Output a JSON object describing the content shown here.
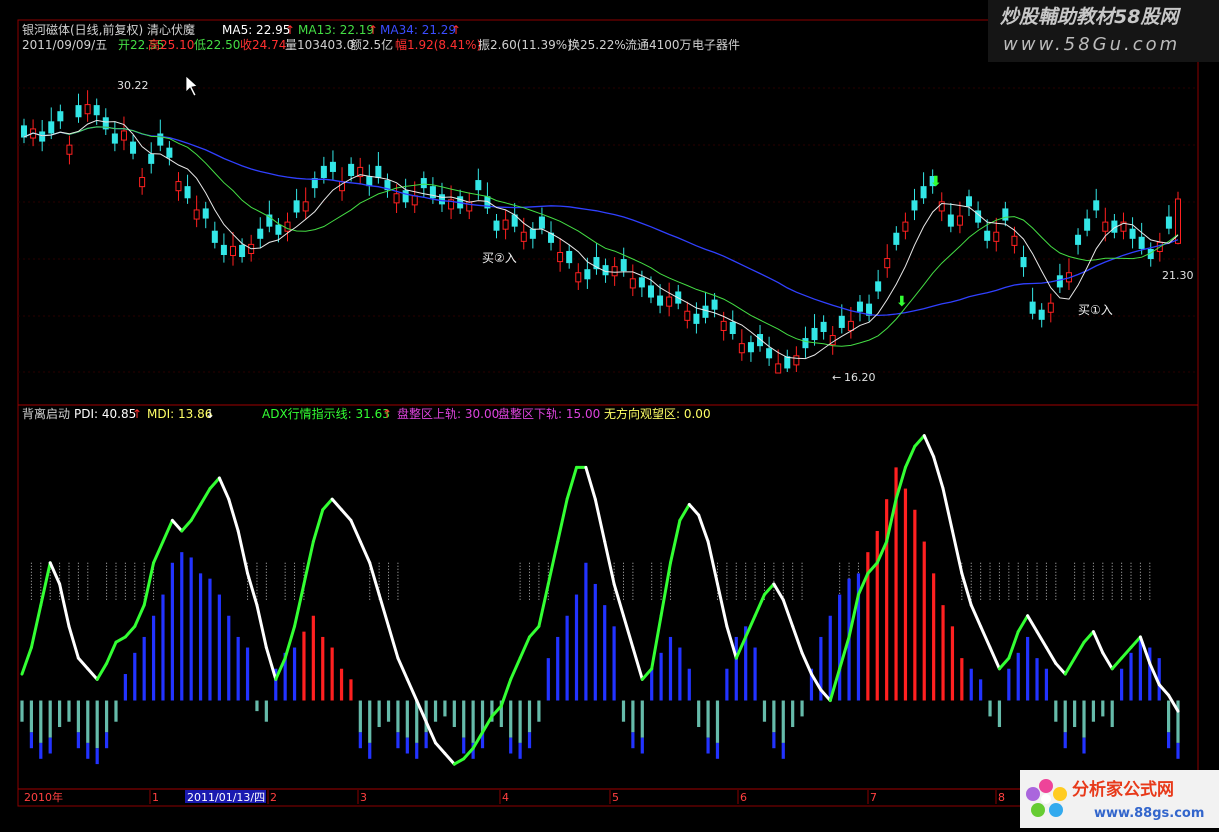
{
  "header": {
    "stock_name": "银河磁体(日线,前复权)",
    "formula_name": "清心伏魔",
    "ma5": "MA5: 22.95",
    "ma13": "MA13: 22.19",
    "ma34": "MA34: 21.29",
    "date": "2011/09/09/五",
    "open": "开22.55",
    "high": "高25.10",
    "low": "低22.50",
    "close": "收24.74",
    "volume": "量103403.0",
    "amount": "额2.5亿",
    "change": "幅1.92(8.41%)",
    "amplitude": "振2.60(11.39%)",
    "turnover": "换25.22%",
    "float_shares": "流通4100万",
    "sector": "电子器件"
  },
  "branding": {
    "top_title": "炒股輔助教材58股网",
    "top_url": "www.58Gu.com",
    "bottom_title": "分析家公式网",
    "bottom_url": "www.88gs.com"
  },
  "indicator": {
    "name": "背离启动",
    "pdi": "PDI: 40.85",
    "mdi": "MDI: 13.86",
    "adx": "ADX行情指示线: 31.63",
    "upper": "盘整区上轨: 30.00",
    "lower": "盘整区下轨: 15.00",
    "neutral": "无方向观望区: 0.00"
  },
  "annotations": {
    "high_label": "30.22",
    "low_label": "16.20",
    "right_price": "21.30",
    "buy1": "买①入",
    "buy2": "买②入"
  },
  "timeline": {
    "year": "2010年",
    "cursor_date": "2011/01/13/四",
    "months": [
      "1",
      "2",
      "3",
      "4",
      "5",
      "6",
      "7",
      "8"
    ]
  },
  "colors": {
    "background": "#000000",
    "up_candle": "#ff2020",
    "down_candle": "#33e6e6",
    "ma5": "#ffffff",
    "ma13": "#44dd44",
    "ma34": "#3040ff",
    "grid": "#8b0000",
    "pdi_bar": "#ff2020",
    "mdi_bar": "#2233ff",
    "adx_up": "#33ff33",
    "adx_down": "#ffffff"
  },
  "chart_data": [
    {
      "type": "candlestick",
      "title": "银河磁体(日线,前复权)",
      "ylim": [
        16.2,
        30.22
      ],
      "price_high": 30.22,
      "price_low": 16.2,
      "last_bar": {
        "open": 22.55,
        "high": 25.1,
        "low": 22.5,
        "close": 24.74
      },
      "close_series": [
        27.8,
        28.2,
        27.6,
        28.0,
        28.6,
        27.4,
        28.8,
        29.4,
        28.9,
        28.2,
        27.5,
        28.1,
        27.0,
        25.8,
        26.5,
        27.4,
        26.8,
        25.6,
        24.8,
        24.2,
        23.8,
        22.6,
        22.0,
        22.4,
        21.9,
        22.5,
        22.8,
        23.4,
        23.0,
        23.6,
        24.1,
        24.6,
        25.3,
        25.8,
        26.1,
        25.6,
        25.9,
        26.3,
        25.4,
        25.8,
        25.2,
        25.0,
        24.6,
        24.9,
        25.3,
        24.8,
        24.5,
        24.7,
        24.3,
        24.6,
        25.2,
        24.3,
        23.2,
        23.7,
        23.4,
        23.1,
        22.8,
        23.3,
        22.6,
        22.1,
        21.6,
        21.1,
        20.8,
        21.3,
        21.0,
        21.4,
        21.2,
        20.8,
        20.4,
        19.9,
        19.5,
        19.9,
        19.6,
        19.2,
        18.6,
        18.9,
        19.3,
        18.7,
        18.1,
        17.6,
        17.2,
        17.5,
        16.9,
        16.6,
        16.4,
        17.0,
        17.4,
        17.8,
        18.2,
        18.0,
        18.4,
        18.7,
        19.2,
        19.0,
        20.2,
        21.8,
        22.5,
        23.6,
        24.2,
        24.8,
        25.4,
        24.6,
        23.4,
        23.9,
        24.4,
        23.6,
        22.7,
        23.1,
        23.7,
        22.9,
        21.4,
        19.1,
        18.8,
        19.6,
        20.4,
        21.1,
        22.5,
        23.2,
        24.2,
        23.6,
        23.1,
        23.6,
        22.8,
        22.3,
        21.8,
        22.6,
        23.3,
        24.74
      ],
      "series": [
        {
          "name": "MA5",
          "value": 22.95
        },
        {
          "name": "MA13",
          "value": 22.19
        },
        {
          "name": "MA34",
          "value": 21.29
        }
      ]
    },
    {
      "type": "bar",
      "title": "背离启动",
      "ylim": [
        -15,
        52
      ],
      "adx": [
        5,
        10,
        18,
        26,
        22,
        14,
        8,
        6,
        4,
        7,
        11,
        12,
        14,
        18,
        26,
        30,
        34,
        32,
        34,
        37,
        40,
        42,
        38,
        32,
        24,
        18,
        10,
        4,
        8,
        14,
        22,
        30,
        36,
        38,
        36,
        34,
        30,
        26,
        20,
        14,
        8,
        4,
        0,
        -4,
        -8,
        -10,
        -12,
        -11,
        -9,
        -6,
        -3,
        -1,
        4,
        8,
        12,
        14,
        22,
        30,
        38,
        44,
        44,
        38,
        30,
        22,
        16,
        10,
        4,
        6,
        16,
        26,
        34,
        37,
        35,
        30,
        22,
        14,
        8,
        12,
        16,
        20,
        22,
        19,
        14,
        9,
        5,
        2,
        0,
        6,
        12,
        20,
        24,
        26,
        30,
        38,
        44,
        48,
        50,
        46,
        40,
        32,
        24,
        18,
        14,
        10,
        6,
        8,
        13,
        16,
        13,
        10,
        7,
        5,
        8,
        11,
        13,
        9,
        6,
        8,
        10,
        12,
        7,
        3,
        1,
        -2,
        -4,
        2,
        8
      ],
      "pdi_minus_mdi": [
        -4,
        -6,
        -8,
        -7,
        -5,
        -4,
        -6,
        -8,
        -9,
        -6,
        -4,
        5,
        9,
        12,
        16,
        20,
        26,
        28,
        27,
        24,
        23,
        20,
        16,
        12,
        10,
        -2,
        -4,
        6,
        9,
        10,
        13,
        16,
        12,
        10,
        6,
        4,
        -6,
        -8,
        -5,
        -4,
        -6,
        -7,
        -8,
        -6,
        -4,
        -3,
        -5,
        -7,
        -8,
        -6,
        -4,
        -5,
        -7,
        -8,
        -6,
        -4,
        8,
        12,
        16,
        20,
        26,
        22,
        18,
        14,
        -4,
        -6,
        -7,
        6,
        9,
        12,
        10,
        6,
        -5,
        -7,
        -8,
        6,
        12,
        14,
        10,
        -4,
        -6,
        -8,
        -5,
        -3,
        6,
        12,
        16,
        20,
        23,
        24,
        28,
        32,
        38,
        44,
        40,
        36,
        30,
        24,
        18,
        14,
        8,
        6,
        4,
        -3,
        -5,
        6,
        9,
        12,
        8,
        6,
        -4,
        -6,
        -5,
        -7,
        -4,
        -3,
        -5,
        6,
        9,
        12,
        10,
        8,
        -6,
        -8
      ]
    }
  ]
}
